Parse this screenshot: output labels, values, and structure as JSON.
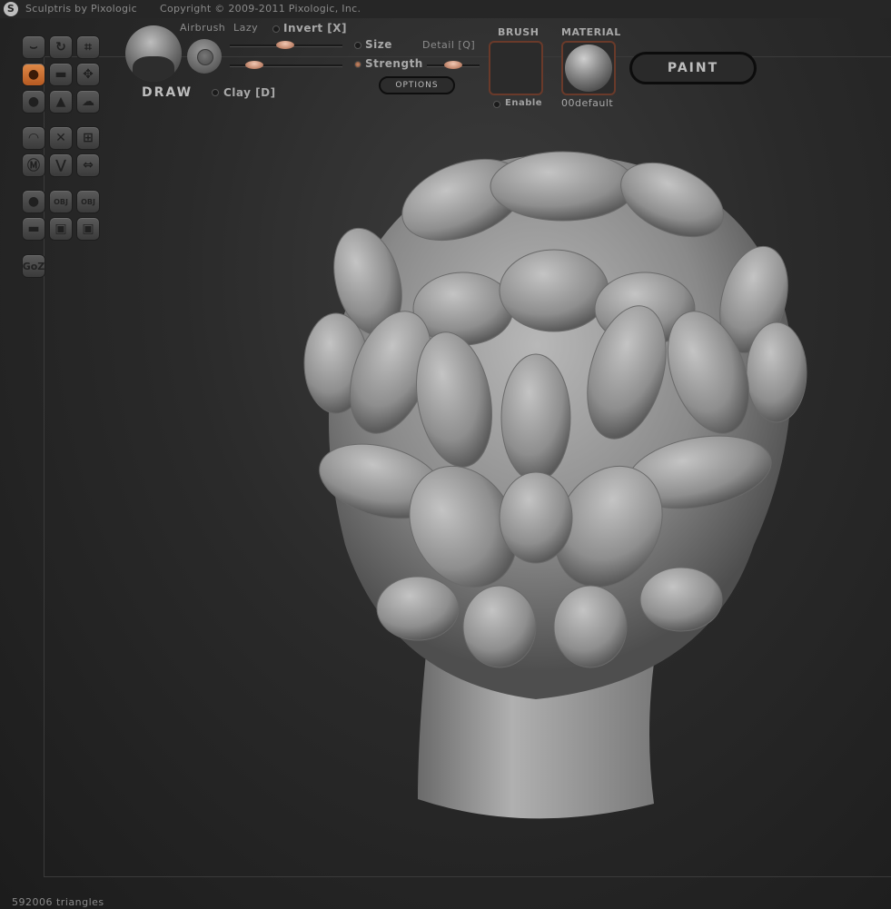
{
  "titlebar": {
    "logo_glyph": "S",
    "app_name": "Sculptris by Pixologic",
    "copyright": "Copyright © 2009-2011 Pixologic, Inc."
  },
  "toolbar": {
    "brush_name": "DRAW",
    "airbrush_label": "Airbrush",
    "lazy_label": "Lazy",
    "invert_label": "Invert [X]",
    "size_label": "Size",
    "detail_label": "Detail [Q]",
    "strength_label": "Strength",
    "clay_label": "Clay [D]",
    "options_label": "OPTIONS",
    "brush_header": "BRUSH",
    "enable_label": "Enable",
    "material_header": "MATERIAL",
    "material_name": "00default",
    "paint_label": "PAINT"
  },
  "sliders": {
    "size": 0.49,
    "strength": 0.16,
    "detail": 0.5
  },
  "tools": {
    "obj_import_label": "OBJ",
    "obj_export_label": "OBJ",
    "goz_label": "GoZ",
    "active_tool": "draw",
    "icons": [
      "crease-icon",
      "rotate-icon",
      "scale-icon",
      "draw-icon",
      "flatten-icon",
      "grab-icon",
      "inflate-icon",
      "pinch-icon",
      "smooth-icon",
      "reduce-brush-icon",
      "mask-icon",
      "plane-icon",
      "symmetry-icon",
      "wireframe-icon",
      "mirror-icon",
      "sphere-icon",
      "import-icon",
      "export-icon",
      "open-icon",
      "save-icon",
      "save-as-icon",
      "goz-icon"
    ]
  },
  "status": {
    "triangle_count": "592006 triangles"
  },
  "colors": {
    "accent": "#c8743a",
    "slider_knob": "#d9a68e",
    "background": "#2a2a2a"
  }
}
